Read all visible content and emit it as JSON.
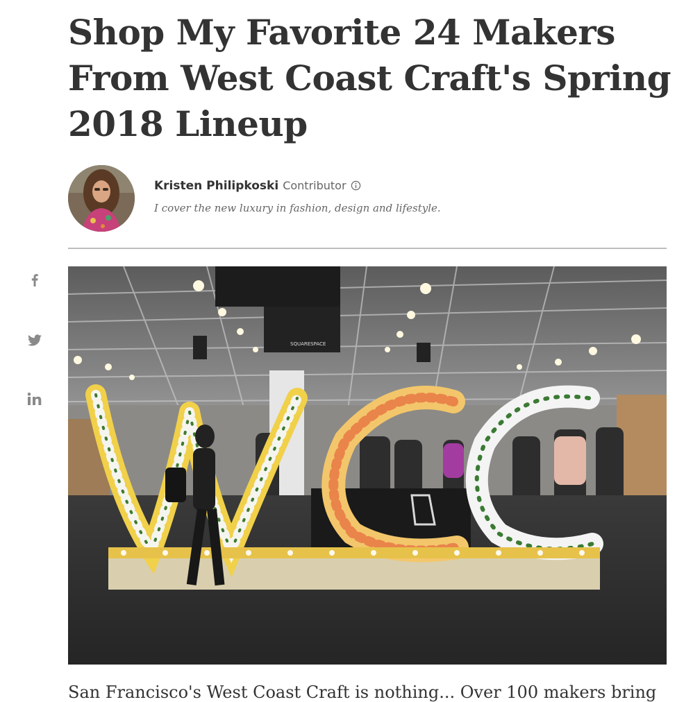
{
  "article": {
    "title": "Shop My Favorite 24 Makers From West Coast Craft's Spring 2018 Lineup",
    "title_lines": [
      "Shop My Favorite 24 Makers",
      "From West Coast Craft's Spring",
      "2018 Lineup"
    ]
  },
  "author": {
    "name": "Kristen Philipkoski",
    "role": "Contributor",
    "bio": "I cover the new luxury in fashion, design and lifestyle.",
    "avatar_icon": "author-avatar"
  },
  "share": {
    "icons": [
      "facebook-icon",
      "twitter-icon",
      "linkedin-icon"
    ]
  },
  "hero_image": {
    "subject": "floral wcc letters",
    "banner_text": "SQUARESPACE"
  },
  "teaser": {
    "text": "San Francisco's West Coast Craft is nothing... Over 100 makers bring"
  },
  "colors": {
    "text": "#333333",
    "muted": "#666666",
    "divider": "#bdbdbd",
    "icon": "#8a8a8a"
  }
}
